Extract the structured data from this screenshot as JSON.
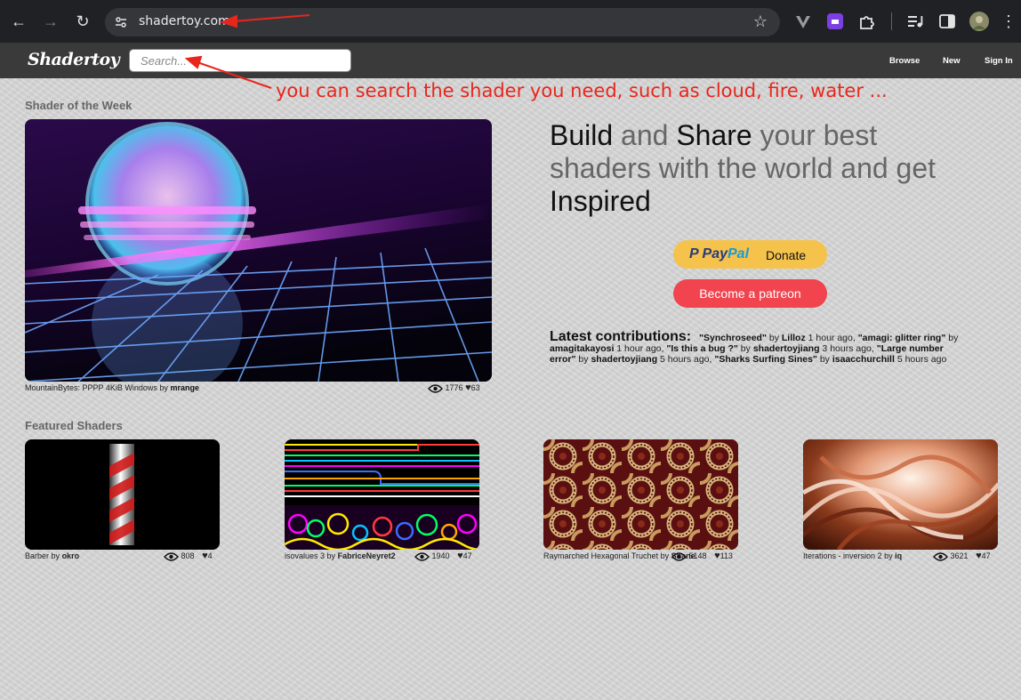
{
  "browser": {
    "url": "shadertoy.com",
    "colors": {
      "chrome_bg": "#202124",
      "omnibox_bg": "#35363a"
    }
  },
  "site": {
    "logo": "Shadertoy",
    "search_placeholder": "Search...",
    "nav": {
      "browse": "Browse",
      "new": "New",
      "signin": "Sign In"
    }
  },
  "annotation": {
    "text": "you can search the shader you need, such as cloud, fire, water ...",
    "color": "#e8261c"
  },
  "shader_of_week": {
    "heading": "Shader of the Week",
    "title": "MountainBytes: PPPP 4KiB Windows",
    "by": "by",
    "author": "mrange",
    "views": "1776",
    "likes": "63"
  },
  "hero": {
    "w1": "Build",
    "w2": " and ",
    "w3": "Share",
    "w4": " your best shaders with the world and get ",
    "w5": "Inspired"
  },
  "donate": {
    "paypal_pay": "Pay",
    "paypal_pal": "Pal",
    "paypal_donate": "Donate",
    "patreon": "Become a patreon",
    "colors": {
      "paypal": "#f5c24c",
      "patreon": "#f1444f"
    }
  },
  "latest": {
    "title": "Latest contributions:",
    "items": [
      {
        "name": "\"Synchroseed\"",
        "by": " by ",
        "author": "Lilloz",
        "time": " 1 hour ago, "
      },
      {
        "name": "\"amagi: glitter ring\"",
        "by": " by ",
        "author": "amagitakayosi",
        "time": " 1 hour ago, "
      },
      {
        "name": "\"Is this a bug ?\"",
        "by": " by ",
        "author": "shadertoyjiang",
        "time": " 3 hours ago, "
      },
      {
        "name": "\"Large number error\"",
        "by": " by ",
        "author": "shadertoyjiang",
        "time": " 5 hours ago, "
      },
      {
        "name": "\"Sharks Surfing Sines\"",
        "by": " by ",
        "author": "isaacchurchill",
        "time": " 5 hours ago"
      }
    ]
  },
  "featured": {
    "heading": "Featured Shaders",
    "items": [
      {
        "title": "Barber",
        "by": "by",
        "author": "okro",
        "views": "808",
        "likes": "4"
      },
      {
        "title": "isovalues 3",
        "by": "by",
        "author": "FabriceNeyret2",
        "views": "1940",
        "likes": "47"
      },
      {
        "title": "Raymarched Hexagonal Truchet",
        "by": "by",
        "author": "Shane",
        "views": "5148",
        "likes": "113"
      },
      {
        "title": "Iterations - inversion 2",
        "by": "by",
        "author": "iq",
        "views": "3621",
        "likes": "47"
      }
    ]
  }
}
